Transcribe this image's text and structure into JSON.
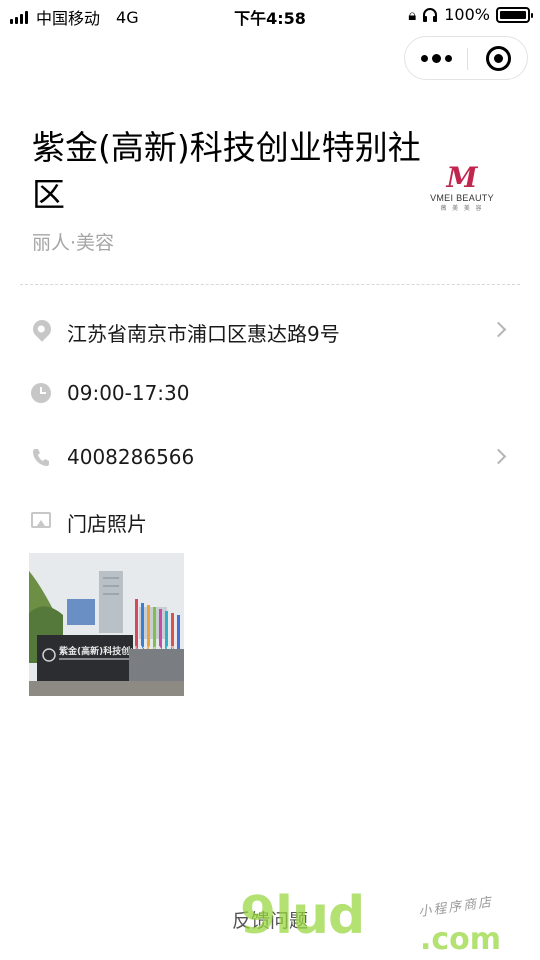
{
  "status_bar": {
    "carrier": "中国移动",
    "network": "4G",
    "time": "下午4:58",
    "battery": "100%"
  },
  "store": {
    "title": "紫金(高新)科技创业特别社区",
    "category": "丽人·美容",
    "logo": {
      "mark": "M",
      "name": "VMEI BEAUTY",
      "sub": "薇 美 美 容"
    }
  },
  "info": {
    "address": "江苏省南京市浦口区惠达路9号",
    "hours": "09:00-17:30",
    "phone": "4008286566",
    "photos_label": "门店照片"
  },
  "photo": {
    "sign_text": "紫金(高新)科技创业特别社区"
  },
  "footer": {
    "feedback": "反馈问题"
  },
  "watermark": {
    "main": "9lud",
    "com": ".com",
    "sub": "小程序商店"
  },
  "colors": {
    "icon_gray": "#c7c7c7",
    "category_gray": "#a6a6a6",
    "logo_red": "#c1264e",
    "watermark_green": "#96d63c"
  },
  "icons": [
    "signal-icon",
    "lock-icon",
    "headphone-icon",
    "battery-icon",
    "more-icon",
    "close-icon",
    "location-icon",
    "clock-icon",
    "phone-icon",
    "image-icon",
    "chevron-right-icon"
  ]
}
